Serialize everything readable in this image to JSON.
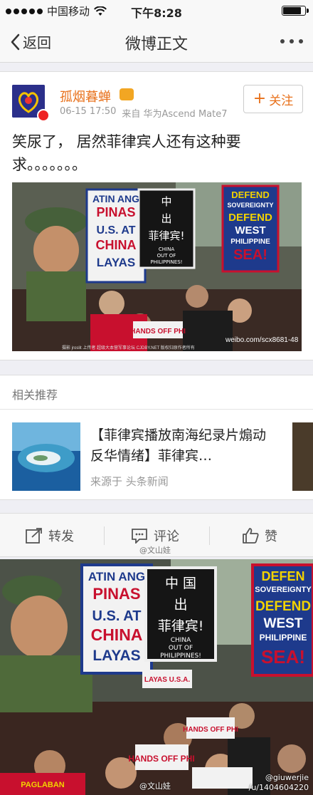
{
  "status_bar": {
    "carrier": "中国移动",
    "time": "下午8:28",
    "battery_level": 0.85
  },
  "nav": {
    "back_label": "返回",
    "title": "微博正文"
  },
  "post": {
    "user_name": "孤烟暮蝉",
    "date": "06-15 17:50",
    "source": "来自 华为Ascend Mate7",
    "follow_label": "关注",
    "text": "笑尿了， 居然菲律宾人还有这种要求。。。。。。。",
    "image": {
      "sign1_lines": [
        "ATIN ANG",
        "PINAS",
        "U.S. AT",
        "CHINA",
        "LAYAS"
      ],
      "sign2_cn": [
        "中",
        "出",
        "菲律宾!"
      ],
      "sign2_en": [
        "CHINA",
        "OUT OF",
        "PHILIPPINES!"
      ],
      "sign3_lines": [
        "DEFEND",
        "SOVEREIGNTY",
        "DEFEND",
        "WEST",
        "PHILIPPINE",
        "SEA!"
      ],
      "sign_small": "HANDS OFF PHI",
      "watermark": "weibo.com/scx8681-48",
      "caption": "摄影 jroslit 上传者 超级大本营军事论坛 CJDBY.NET 版权归原作者所有"
    }
  },
  "related": {
    "header": "相关推荐",
    "title": "【菲律宾播放南海纪录片煽动反华情绪】菲律宾…",
    "source": "来源于 头条新闻"
  },
  "actions": {
    "repost": "转发",
    "comment": "评论",
    "like": "赞"
  },
  "watermarks": {
    "mid": "@文山娃",
    "bottom_left": "@文山娃",
    "bottom_right_1": "@giuwerjie",
    "bottom_right_2": "/u/1404604220"
  },
  "bottom_image": {
    "sign1_lines": [
      "ATIN ANG",
      "PINAS",
      "U.S. AT",
      "CHINA",
      "LAYAS"
    ],
    "sign2_cn": [
      "中 国",
      "出",
      "菲律宾!"
    ],
    "sign2_en": [
      "CHINA",
      "OUT OF",
      "PHILIPPINES!"
    ],
    "sign3_lines": [
      "DEFEN",
      "SOVEREIGNTY",
      "DEFEND",
      "WEST",
      "PHILIPPINE",
      "SEA!"
    ],
    "sign_small_1": "LAYAS U.S.A.",
    "sign_small_2": "HANDS OFF PHI",
    "sign_small_3": "HANDS OFF PHI",
    "sign_small_4": "PAGLABAN"
  },
  "colors": {
    "accent": "#e8701a",
    "brand_avatar": "#2b2f8a",
    "sign_red": "#c8102e",
    "sign_blue": "#1e3a8c",
    "sign_black": "#151515"
  }
}
